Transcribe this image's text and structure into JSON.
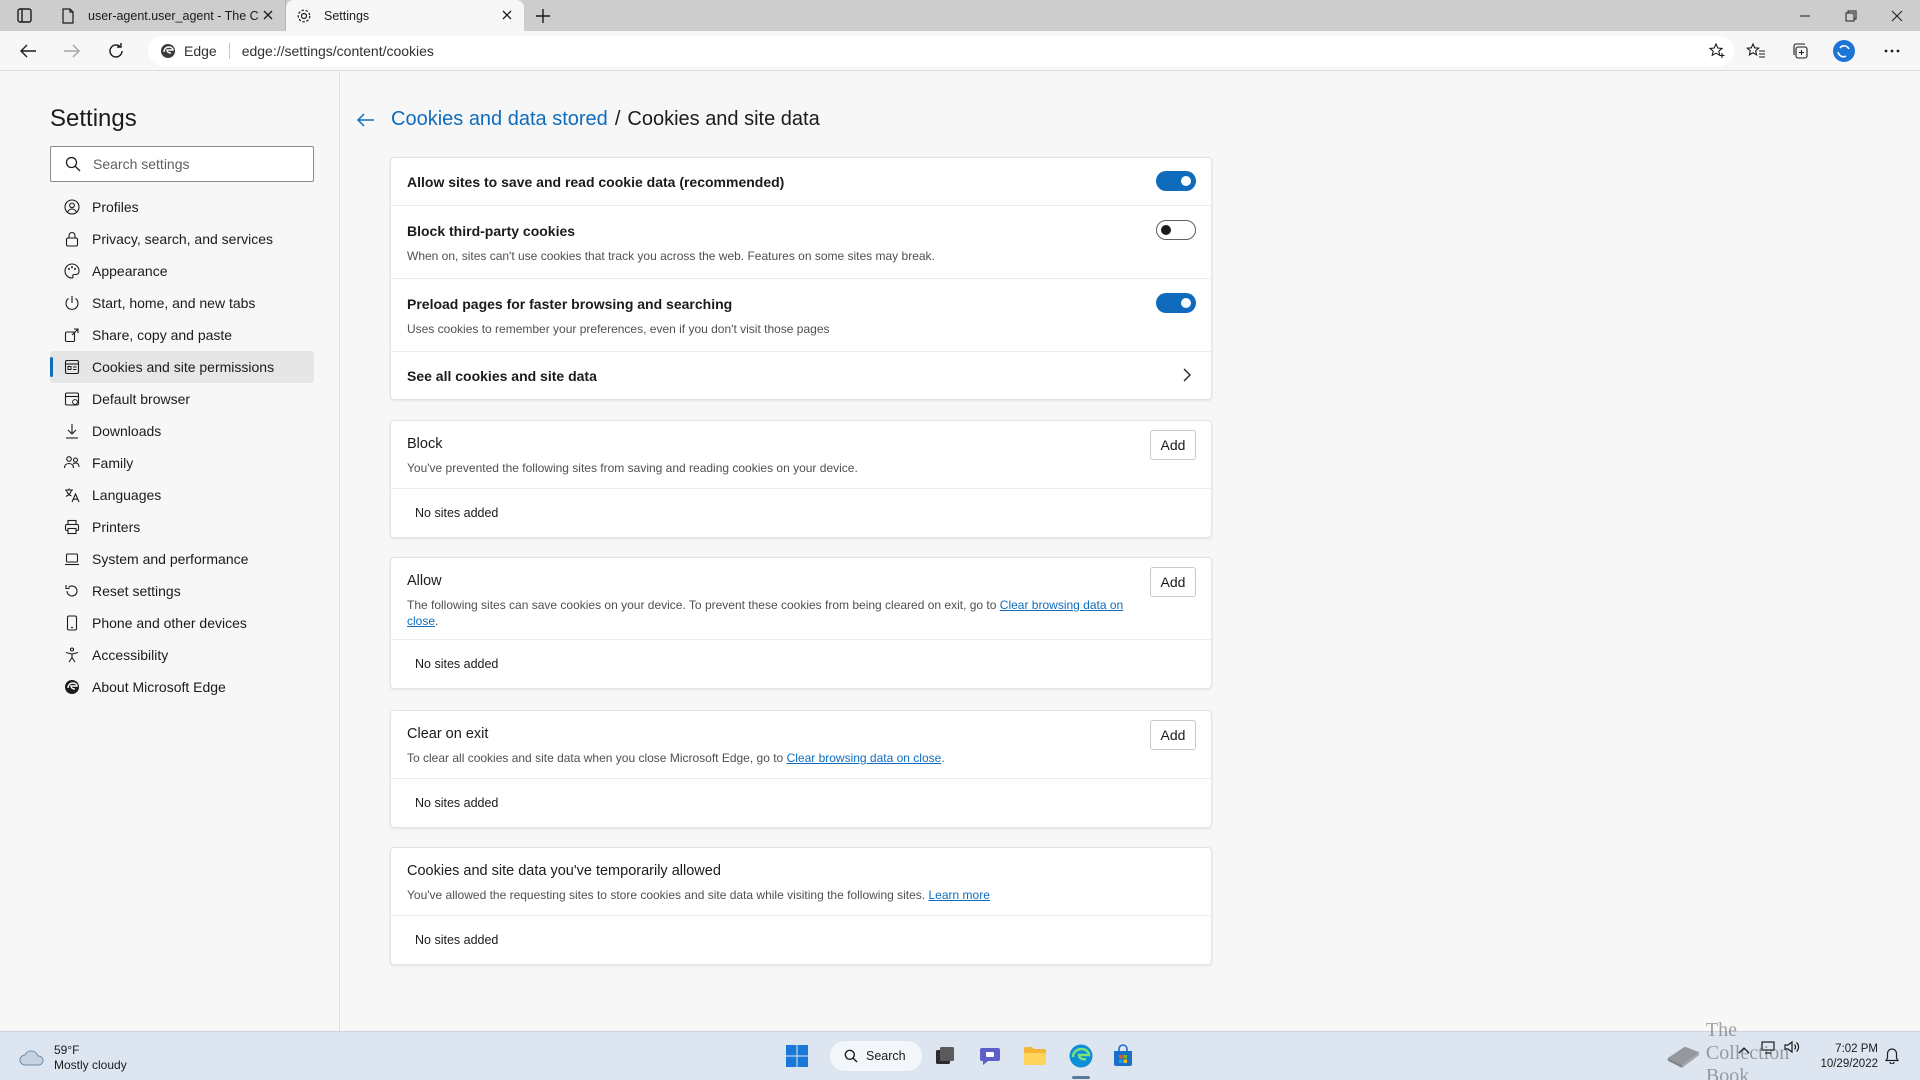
{
  "browser": {
    "tabs": [
      {
        "title": "user-agent.user_agent - The Col",
        "active": false,
        "icon": "page-icon"
      },
      {
        "title": "Settings",
        "active": true,
        "icon": "gear-icon"
      }
    ],
    "address": {
      "edge_label": "Edge",
      "url": "edge://settings/content/cookies"
    }
  },
  "sidebar": {
    "title": "Settings",
    "search_placeholder": "Search settings",
    "items": [
      {
        "label": "Profiles",
        "icon": "profile-icon"
      },
      {
        "label": "Privacy, search, and services",
        "icon": "lock-icon"
      },
      {
        "label": "Appearance",
        "icon": "appearance-icon"
      },
      {
        "label": "Start, home, and new tabs",
        "icon": "power-icon"
      },
      {
        "label": "Share, copy and paste",
        "icon": "share-icon"
      },
      {
        "label": "Cookies and site permissions",
        "icon": "cookies-icon",
        "active": true
      },
      {
        "label": "Default browser",
        "icon": "browser-icon"
      },
      {
        "label": "Downloads",
        "icon": "download-icon"
      },
      {
        "label": "Family",
        "icon": "family-icon"
      },
      {
        "label": "Languages",
        "icon": "languages-icon"
      },
      {
        "label": "Printers",
        "icon": "printer-icon"
      },
      {
        "label": "System and performance",
        "icon": "laptop-icon"
      },
      {
        "label": "Reset settings",
        "icon": "reset-icon"
      },
      {
        "label": "Phone and other devices",
        "icon": "phone-icon"
      },
      {
        "label": "Accessibility",
        "icon": "accessibility-icon"
      },
      {
        "label": "About Microsoft Edge",
        "icon": "edge-icon"
      }
    ]
  },
  "main": {
    "breadcrumb": {
      "parent": "Cookies and data stored",
      "separator": "/",
      "current": "Cookies and site data"
    },
    "settings": {
      "allow_cookies": {
        "title": "Allow sites to save and read cookie data (recommended)",
        "enabled": true
      },
      "block_third_party": {
        "title": "Block third-party cookies",
        "desc": "When on, sites can't use cookies that track you across the web. Features on some sites may break.",
        "enabled": false
      },
      "preload": {
        "title": "Preload pages for faster browsing and searching",
        "desc": "Uses cookies to remember your preferences, even if you don't visit those pages",
        "enabled": true
      },
      "see_all": {
        "title": "See all cookies and site data"
      }
    },
    "block": {
      "title": "Block",
      "desc": "You've prevented the following sites from saving and reading cookies on your device.",
      "add_label": "Add",
      "empty": "No sites added"
    },
    "allow": {
      "title": "Allow",
      "desc": "The following sites can save cookies on your device. To prevent these cookies from being cleared on exit, go to",
      "link": "Clear browsing data on close",
      "period": ".",
      "add_label": "Add",
      "empty": "No sites added"
    },
    "clear_on_exit": {
      "title": "Clear on exit",
      "desc": "To clear all cookies and site data when you close Microsoft Edge, go to",
      "link": "Clear browsing data on close",
      "period": ".",
      "add_label": "Add",
      "empty": "No sites added"
    },
    "temp_allowed": {
      "title": "Cookies and site data you've temporarily allowed",
      "desc": "You've allowed the requesting sites to store cookies and site data while visiting the following sites.",
      "link": "Learn more",
      "empty": "No sites added"
    }
  },
  "taskbar": {
    "weather_temp": "59°F",
    "weather_desc": "Mostly cloudy",
    "search_label": "Search",
    "time": "7:02 PM",
    "date": "10/29/2022",
    "watermark": "The Collection Book"
  },
  "colors": {
    "accent": "#0f6cbd",
    "taskbar": "#dde6f0"
  }
}
